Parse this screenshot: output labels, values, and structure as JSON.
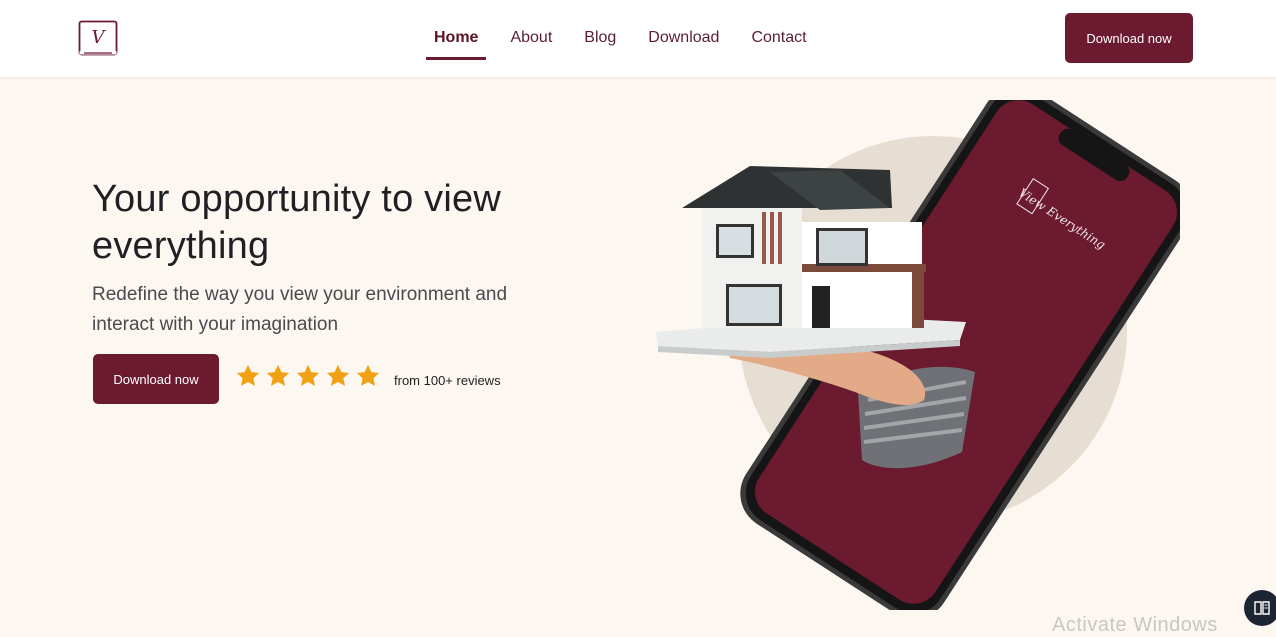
{
  "nav": {
    "logo_letter": "V",
    "links": [
      {
        "label": "Home",
        "active": true
      },
      {
        "label": "About",
        "active": false
      },
      {
        "label": "Blog",
        "active": false
      },
      {
        "label": "Download",
        "active": false
      },
      {
        "label": "Contact",
        "active": false
      }
    ],
    "cta_label": "Download now"
  },
  "hero": {
    "title": "Your opportunity to view everything",
    "subtitle": "Redefine the way you view your environment and interact with your imagination",
    "cta_label": "Download now",
    "rating_stars": 5,
    "reviews_text": "from 100+ reviews",
    "phone_screen_text": "View Everything"
  },
  "overlay": {
    "watermark": "Activate Windows"
  },
  "colors": {
    "brand": "#6b1a30",
    "background": "#fdf7f1",
    "star": "#f0a114",
    "circle": "#e7ded3"
  },
  "icons": [
    "logo-icon",
    "star-icon",
    "reader-icon"
  ]
}
